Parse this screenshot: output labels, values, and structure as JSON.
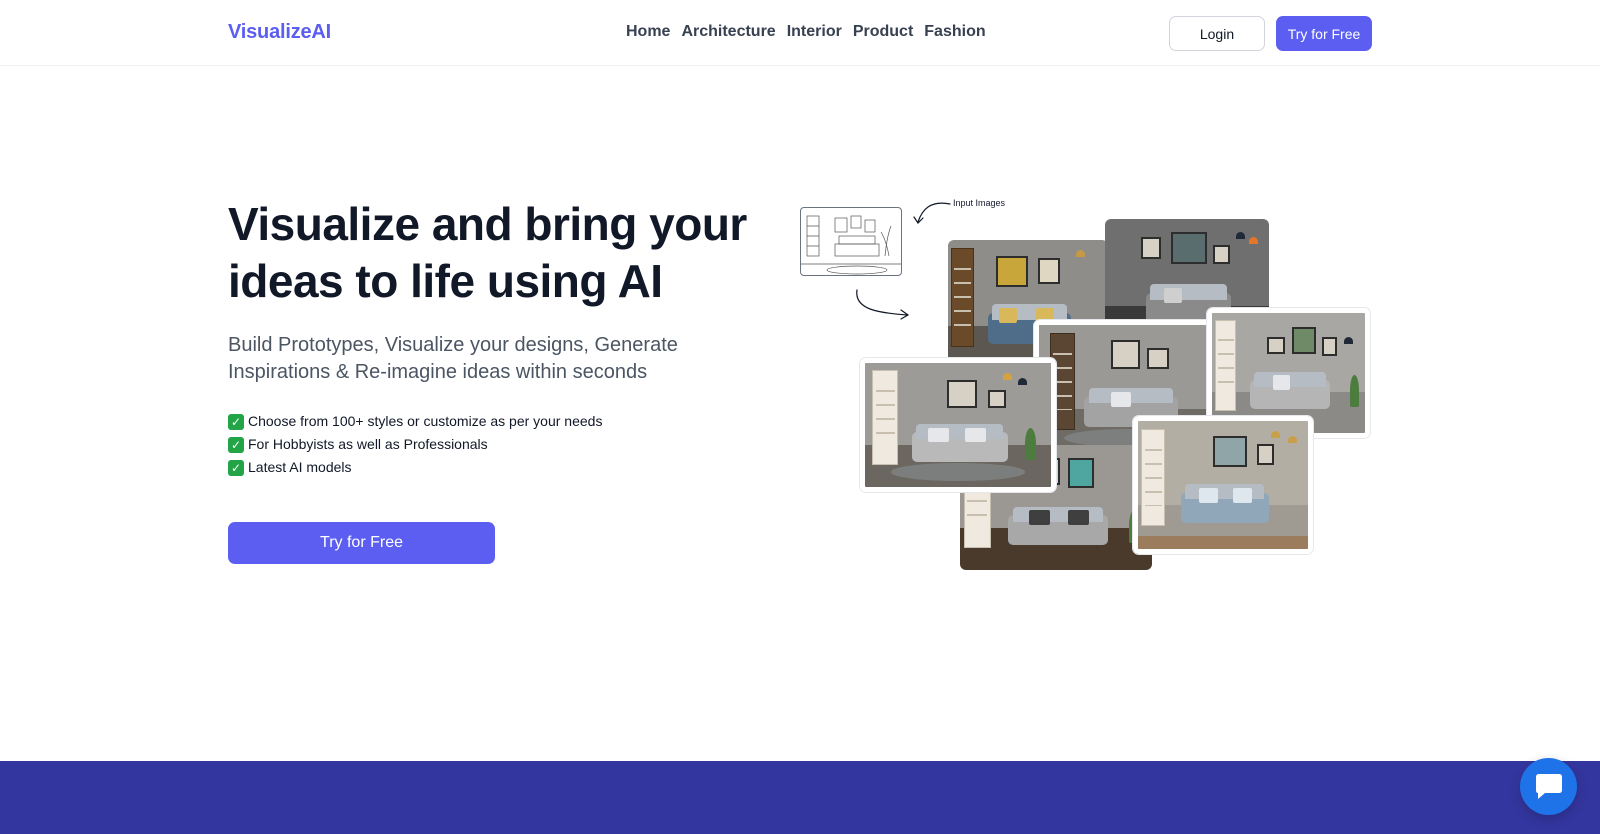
{
  "header": {
    "logo": "VisualizeAI",
    "nav": [
      "Home",
      "Architecture",
      "Interior",
      "Product",
      "Fashion"
    ],
    "login_label": "Login",
    "try_label": "Try for Free"
  },
  "hero": {
    "title": "Visualize and bring your ideas to life using AI",
    "subtitle": "Build Prototypes, Visualize your designs, Generate Inspirations & Re-imagine ideas within seconds",
    "features": [
      "Choose from 100+ styles or customize as per your needs",
      "For Hobbyists as well as Professionals",
      "Latest AI models"
    ],
    "cta_label": "Try for Free"
  },
  "collage": {
    "input_label": "Input Images"
  },
  "colors": {
    "brand": "#5b5ef0",
    "band": "#3436a0",
    "chat": "#1f73e8",
    "check": "#22a447"
  },
  "icons": {
    "check": "check-mark-icon",
    "chat": "chat-bubble-icon",
    "arrow": "curved-arrow-icon"
  }
}
